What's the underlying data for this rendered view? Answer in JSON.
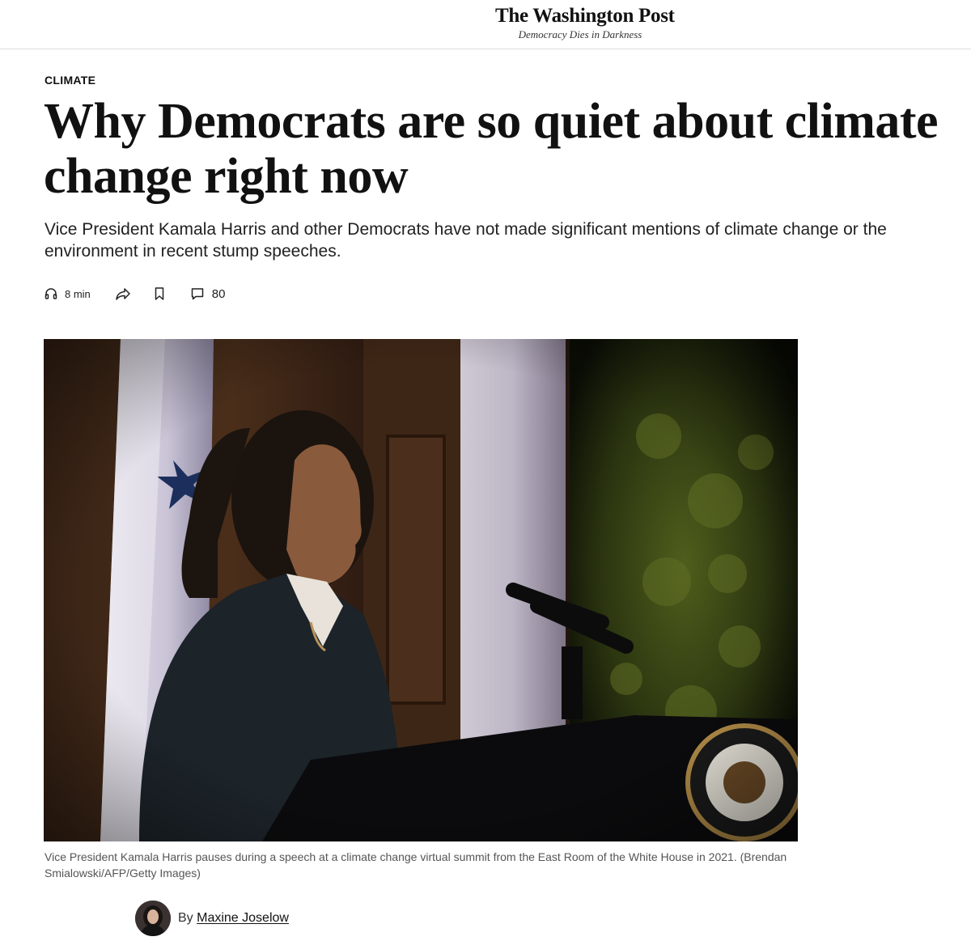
{
  "masthead": {
    "logo_title": "The Washington Post",
    "logo_tagline": "Democracy Dies in Darkness"
  },
  "article": {
    "kicker": "CLIMATE",
    "headline": "Why Democrats are so quiet about climate change right now",
    "dek": "Vice President Kamala Harris and other Democrats have not made significant mentions of climate change or the environment in recent stump speeches."
  },
  "toolbar": {
    "listen_time": "8 min",
    "comment_count": "80",
    "icons": [
      "headphones-icon",
      "share-icon",
      "bookmark-icon",
      "comment-icon"
    ]
  },
  "photo": {
    "caption": "Vice President Kamala Harris pauses during a speech at a climate change virtual summit from the East Room of the White House in 2021. (Brendan Smialowski/AFP/Getty Images)"
  },
  "byline": {
    "prefix": "By",
    "author": "Maxine Joselow"
  },
  "colors": {
    "text": "#111111",
    "caption": "#555555",
    "divider": "#dcdcdc"
  }
}
